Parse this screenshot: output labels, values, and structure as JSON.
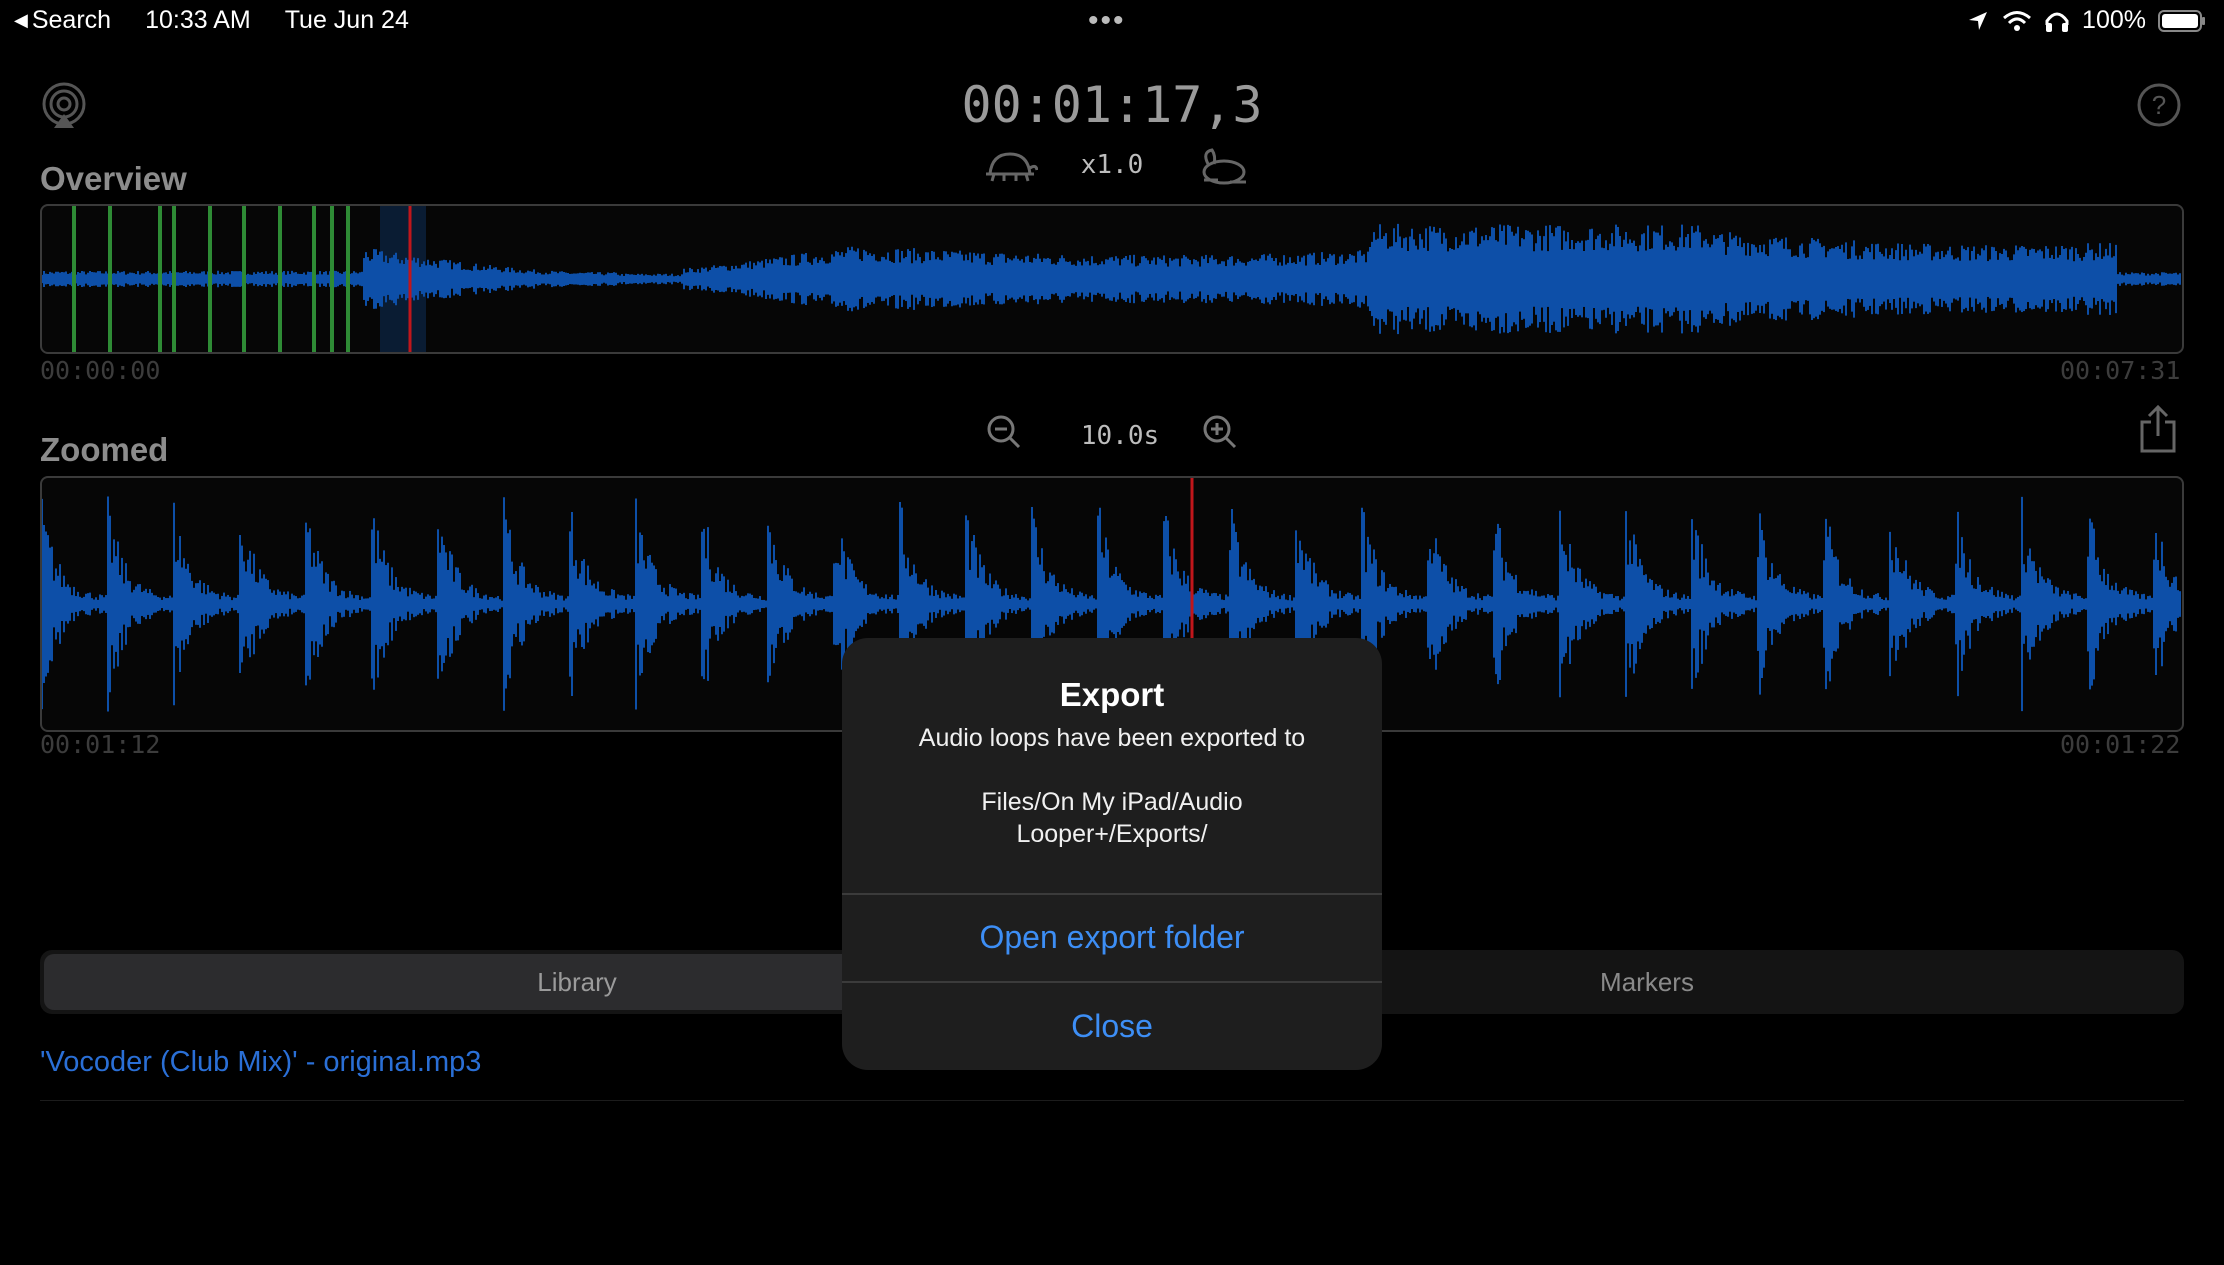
{
  "status_bar": {
    "back_label": "Search",
    "time": "10:33 AM",
    "date": "Tue Jun 24",
    "battery": "100%"
  },
  "player": {
    "current_time": "00:01:17,3",
    "speed": "x1.0"
  },
  "overview": {
    "label": "Overview",
    "start_time": "00:00:00",
    "end_time": "00:07:31"
  },
  "zoomed": {
    "label": "Zoomed",
    "zoom_level": "10.0s",
    "start_time": "00:01:12",
    "end_time": "00:01:22"
  },
  "tabs": {
    "library": "Library",
    "markers": "Markers"
  },
  "library": {
    "file": "'Vocoder (Club Mix)' - original.mp3"
  },
  "dialog": {
    "title": "Export",
    "message": "Audio loops have been exported to\n\nFiles/On My iPad/Audio\nLooper+/Exports/",
    "open_button": "Open export folder",
    "close_button": "Close"
  },
  "colors": {
    "waveform": "#0d4fa8",
    "playhead": "#c0161b",
    "marker": "#2e8b35",
    "link": "#3d8ef5"
  },
  "icons": {
    "airplay": "airplay-icon",
    "help": "help-icon",
    "slow": "turtle-icon",
    "fast": "rabbit-icon",
    "zoom_out": "zoom-out-icon",
    "zoom_in": "zoom-in-icon",
    "share": "share-icon"
  }
}
